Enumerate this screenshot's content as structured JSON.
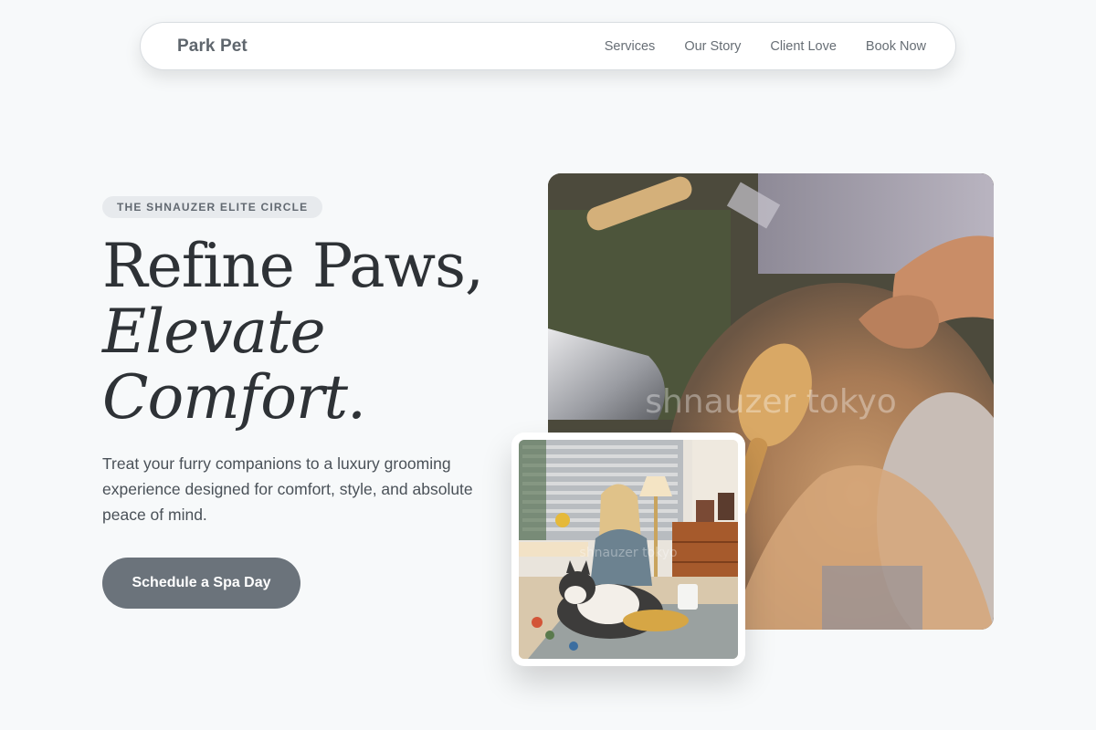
{
  "nav": {
    "brand": "Park Pet",
    "links": [
      {
        "label": "Services"
      },
      {
        "label": "Our Story"
      },
      {
        "label": "Client Love"
      },
      {
        "label": "Book Now"
      }
    ]
  },
  "hero": {
    "eyebrow": "THE SHNAUZER ELITE CIRCLE",
    "headline": {
      "line1": "Refine Paws,",
      "line2": "Elevate",
      "line3": "Comfort."
    },
    "lede": "Treat your furry companions to a luxury grooming experience designed for comfort, style, and absolute peace of mind.",
    "cta_label": "Schedule a Spa Day"
  },
  "images": {
    "main_watermark": "shnauzer tokyo",
    "card_watermark": "shnauzer tokyo"
  },
  "colors": {
    "background": "#f7f9fa",
    "cta": "#6b737b",
    "headline": "#2e3236"
  }
}
